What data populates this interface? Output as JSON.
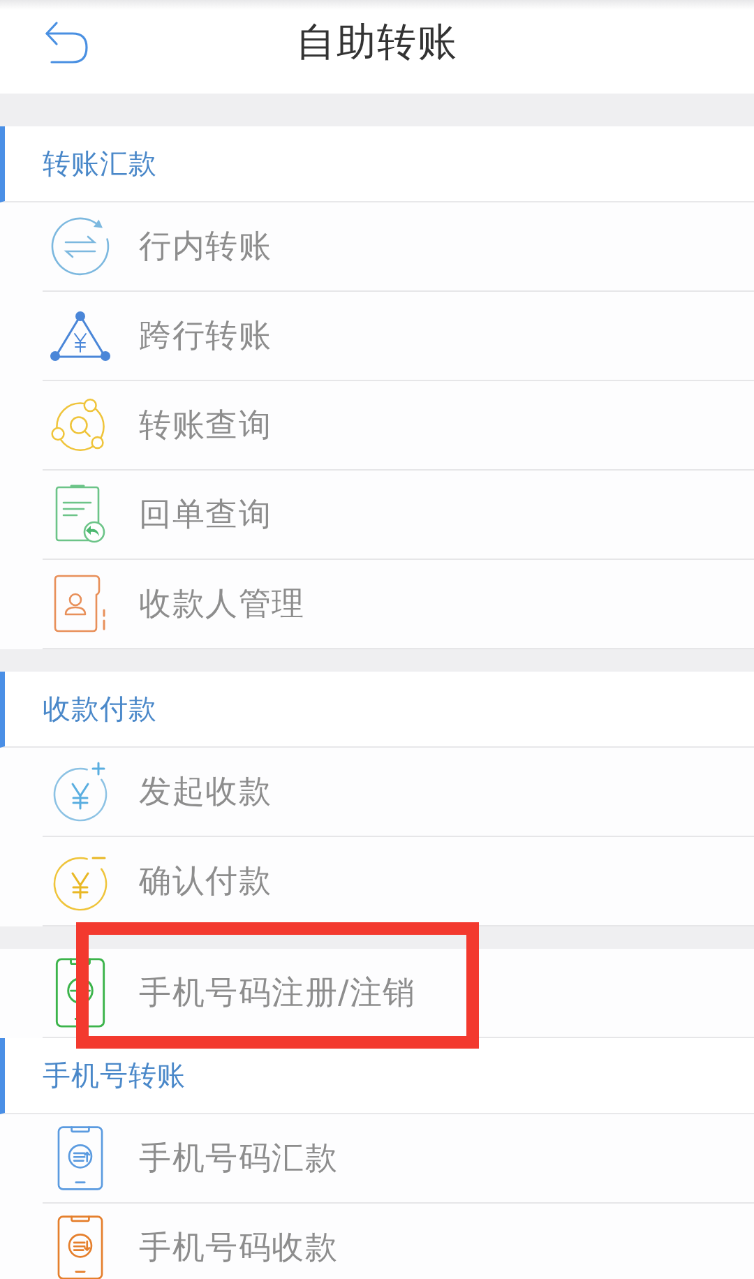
{
  "header": {
    "title": "自助转账"
  },
  "sections": [
    {
      "separated": true,
      "title": "转账汇款",
      "items": [
        {
          "label": "行内转账",
          "highlighted": false
        },
        {
          "label": "跨行转账",
          "highlighted": false
        },
        {
          "label": "转账查询",
          "highlighted": false
        },
        {
          "label": "回单查询",
          "highlighted": false
        },
        {
          "label": "收款人管理",
          "highlighted": false
        }
      ]
    },
    {
      "separated": true,
      "title": "收款付款",
      "items": [
        {
          "label": "发起收款",
          "highlighted": false
        },
        {
          "label": "确认付款",
          "highlighted": false
        }
      ]
    },
    {
      "separated": true,
      "items": [
        {
          "label": "手机号码注册/注销",
          "highlighted": true
        }
      ]
    },
    {
      "separated": false,
      "title": "手机号转账",
      "items": [
        {
          "label": "手机号码汇款",
          "highlighted": false
        },
        {
          "label": "手机号码收款",
          "highlighted": false
        }
      ]
    }
  ]
}
